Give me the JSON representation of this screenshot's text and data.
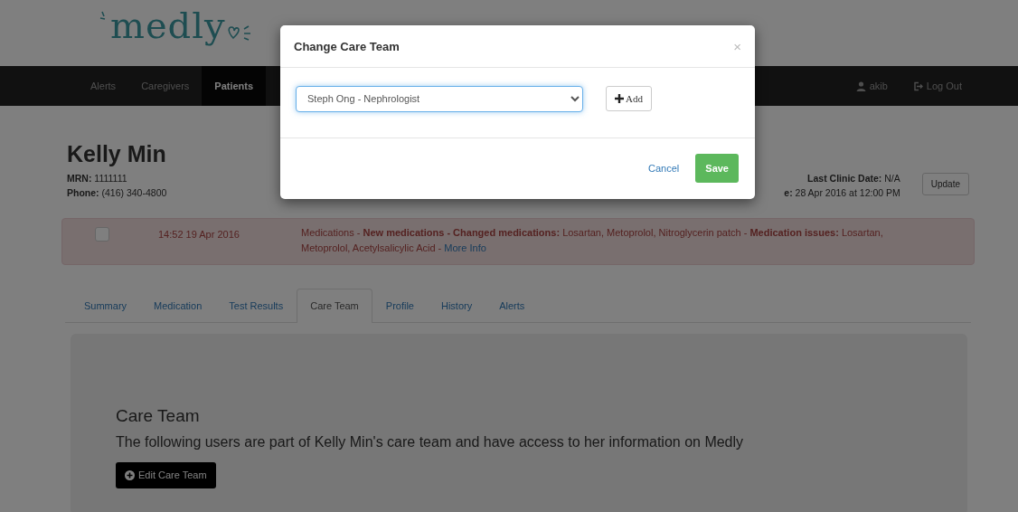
{
  "logo": {
    "text": "medly"
  },
  "nav": {
    "items": [
      {
        "label": "Alerts",
        "selected": false
      },
      {
        "label": "Caregivers",
        "selected": false
      },
      {
        "label": "Patients",
        "selected": true
      }
    ],
    "user": "akib",
    "logout": "Log Out"
  },
  "patient": {
    "name": "Kelly Min",
    "fields": [
      {
        "label": "MRN:",
        "value": "1111111"
      },
      {
        "label": "Phone:",
        "value": "(416) 340-4800"
      }
    ],
    "right_fields": [
      {
        "label": "Last Clinic Date:",
        "value": "N/A"
      },
      {
        "label": "e:",
        "value": "28 Apr 2016 at 12:00 PM"
      }
    ],
    "update_button": "Update"
  },
  "alert": {
    "checked": false,
    "time": "14:52 19 Apr 2016",
    "message": "Medications - **New medications - Changed medications:** Losartan, Metoprolol, Nitroglycerin patch - **Medication issues:** Losartan, Metoprolol, Acetylsalicylic Acid - ",
    "link": "More Info"
  },
  "tabs": [
    {
      "label": "Summary",
      "selected": false
    },
    {
      "label": "Medication",
      "selected": false
    },
    {
      "label": "Test Results",
      "selected": false
    },
    {
      "label": "Care Team",
      "selected": true
    },
    {
      "label": "Profile",
      "selected": false
    },
    {
      "label": "History",
      "selected": false
    },
    {
      "label": "Alerts",
      "selected": false
    }
  ],
  "panel": {
    "heading": "Care Team",
    "text": "The following users are part of Kelly Min's care team and have access to her information on Medly",
    "button": "Edit Care Team"
  },
  "modal": {
    "title": "Change Care Team",
    "close": "×",
    "select_value": "Steph Ong - Nephrologist",
    "add_button": "Add",
    "cancel": "Cancel",
    "save": "Save"
  }
}
